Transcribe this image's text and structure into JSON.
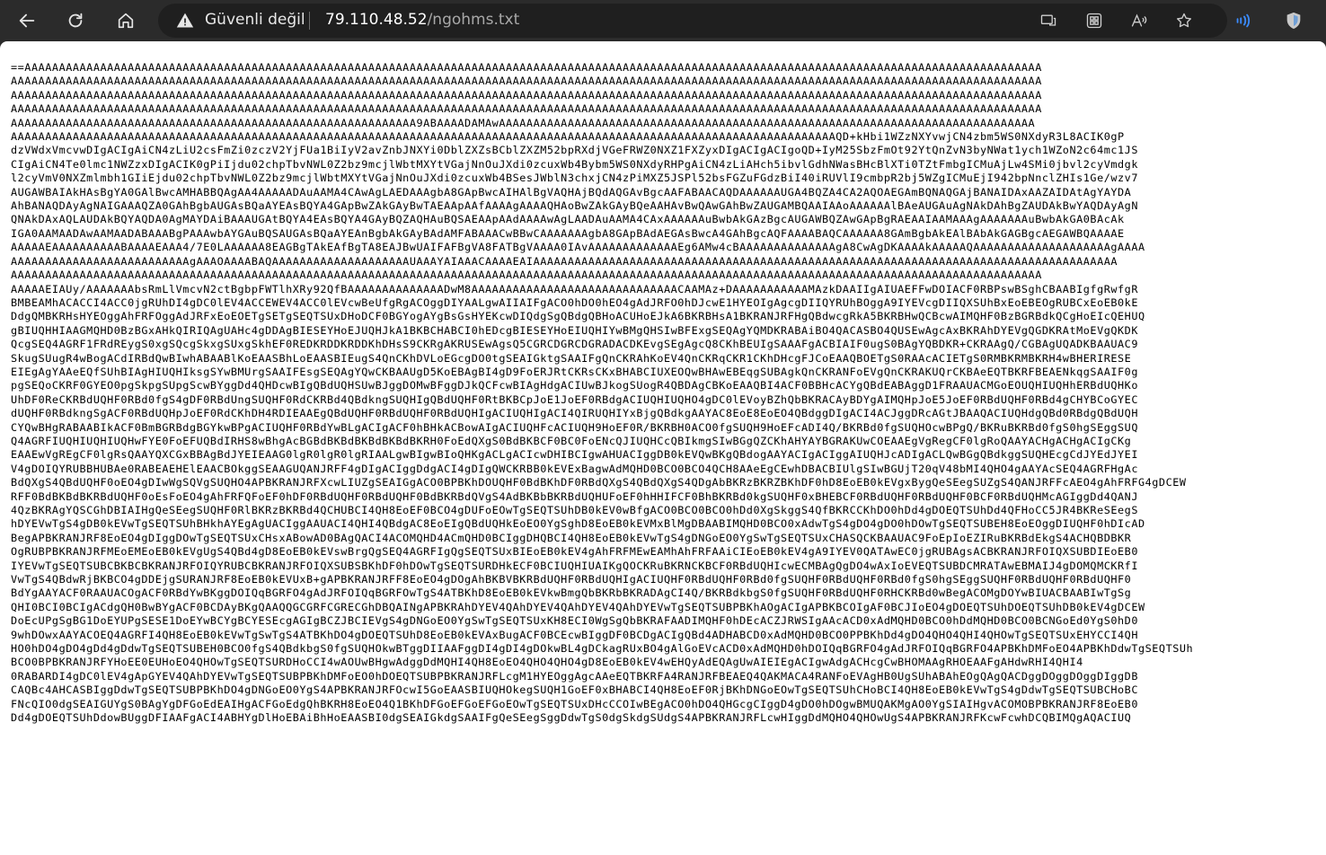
{
  "toolbar": {
    "back_icon": "back-arrow-icon",
    "refresh_icon": "refresh-icon",
    "home_icon": "home-icon"
  },
  "address_bar": {
    "security_icon": "warning-triangle-icon",
    "security_label": "Güvenli değil",
    "url_host": "79.110.48.52",
    "url_path": "/ngohms.txt"
  },
  "address_icons": [
    "app-available-icon",
    "tab-grid-icon",
    "read-aloud-icon",
    "favorite-star-icon"
  ],
  "extension_icons": [
    "audio-extension-icon",
    "shield-extension-icon"
  ],
  "document": {
    "lines": [
      "==AAAAAAAAAAAAAAAAAAAAAAAAAAAAAAAAAAAAAAAAAAAAAAAAAAAAAAAAAAAAAAAAAAAAAAAAAAAAAAAAAAAAAAAAAAAAAAAAAAAAAAAAAAAAAAAAAAAAAAAAAAAAAAAAAAAAAAAAAAAAAAAAAAAA",
      "AAAAAAAAAAAAAAAAAAAAAAAAAAAAAAAAAAAAAAAAAAAAAAAAAAAAAAAAAAAAAAAAAAAAAAAAAAAAAAAAAAAAAAAAAAAAAAAAAAAAAAAAAAAAAAAAAAAAAAAAAAAAAAAAAAAAAAAAAAAAAAAAAAAAAA",
      "AAAAAAAAAAAAAAAAAAAAAAAAAAAAAAAAAAAAAAAAAAAAAAAAAAAAAAAAAAAAAAAAAAAAAAAAAAAAAAAAAAAAAAAAAAAAAAAAAAAAAAAAAAAAAAAAAAAAAAAAAAAAAAAAAAAAAAAAAAAAAAAAAAAAAA",
      "AAAAAAAAAAAAAAAAAAAAAAAAAAAAAAAAAAAAAAAAAAAAAAAAAAAAAAAAAAAAAAAAAAAAAAAAAAAAAAAAAAAAAAAAAAAAAAAAAAAAAAAAAAAAAAAAAAAAAAAAAAAAAAAAAAAAAAAAAAAAAAAAAAAAAA",
      "AAAAAAAAAAAAAAAAAAAAAAAAAAAAAAAAAAAAAAAAAAAAAAAAAAAAAAAAAAA9ABAAAADAMAwAAAAAAAAAAAAAAAAAAAAAAAAAAAAAAAAAAAAAAAAAAAAAAAAAAAAAAAAAAAAAAAAAAAAAAAAAAAAAA",
      "AAAAAAAAAAAAAAAAAAAAAAAAAAAAAAAAAAAAAAAAAAAAAAAAAAAAAAAAAAAAAAAAAAAAAAAAAAAAAAAAAAAAAAAAAAAAAAAAAAAAAAAAAAAAAAAAAAAAAAAAQD+kHbi1WZzNXYvwjCN4zbm5WS0NXdyR3L8ACIK0gP",
      "dzVWdxVmcvwDIgACIgAiCN4zLiU2csFmZi0zczV2YjFUa1BiIyV2avZnbJNXYi0DblZXZsBCblZXZM52bpRXdjVGeFRWZ0NXZ1FXZyxDIgACIgACIgoQD+IyM25SbzFmOt92YtQnZvN3byNWat1ych1WZoN2c64mc1JS",
      "CIgAiCN4Te0lmc1NWZzxDIgACIK0gPiIjdu02chpTbvNWL0Z2bz9mcjlWbtMXYtVGajNnOuJXdi0zcuxWb4Bybm5WS0NXdyRHPgAiCN4zLiAHch5ibvlGdhNWasBHcBlXTi0TZtFmbgICMuAjLw4SMi0jbvl2cyVmdgk",
      "l2cyVmV0NXZmlmbh1GIiEjdu02chpTbvNWL0Z2bz9mcjlWbtMXYtVGajNnOuJXdi0zcuxWb4BSesJWblN3chxjCN4zPiMXZ5JSPl52bsFGZuFGdzBiI40iRUVlI9cmbpR2bj5WZgICMuEjI942bpNnclZHIs1Ge/wzv7",
      "AUGAWBAIAkHAsBgYA0GAlBwcAMHABBQAgAA4AAAAADAuAAMA4CAwAgLAEDAAAgbA8GApBwcAIHAlBgVAQHAjBQdAQGAvBgcAAFABAACAQDAAAAAAUGA4BQZA4CA2AQOAEGAmBQNAQGAjBANAIDAxAAZAIDAtAgYAYDA",
      "AhBANAQDAyAgNAIGAAAQZA0GAhBgbAUGAsBQaAYEAsBQYA4GApBwZAkGAyBwTAEAApAAfAAAAgAAAAQHAoBwZAkGAyBQeAAHAvBwQAwGAhBwZAUGAMBQAAIAAoAAAAAAlBAeAUGAuAgNAkDAhBgZAUDAkBwYAQDAyAgN",
      "QNAkDAxAQLAUDAkBQYAQDA0AgMAYDAiBAAAUGAtBQYA4EAsBQYA4GAyBQZAQHAuBQSAEAApAAdAAAAwAgLAADAuAAMA4CAxAAAAAAuBwbAkGAzBgcAUGAWBQZAwGApBgRAEAAIAAMAAAgAAAAAAAuBwbAkGA0BAcAk",
      "IGA0AAMAADAwAAMAADABAAABgPAAAwbAYGAuBQSAUGAsBQaAYEAnBgbAkGAyBAdAMFABAAACwBBwCAAAAAAAgbA8GApBAdAEGAsBwcA4GAhBgcAQFAAAABAQCAAAAAA8GAmBgbAkEAlBAbAkGAGBgcAEGAWBQAAAAE",
      "AAAAAEAAAAAAAAAABAAAAEAAA4/7E0LAAAAAA8EAGBgTAkEAfBgTA8EAJBwUAIFAFBgVA8FATBgVAAAA0IAvAAAAAAAAAAAAAEg6AMw4cBAAAAAAAAAAAAAAgA8CwAgDKAAAAkAAAAAQAAAAAAAAAAAAAAAAAAAAgAAAA",
      "AAAAAAAAAAAAAAAAAAAAAAAAAAgAAAOAAAABAQAAAAAAAAAAAAAAAAAAAAUAAAYAIAAACAAAAEAIAAAAAAAAAAAAAAAAAAAAAAAAAAAAAAAAAAAAAAAAAAAAAAAAAAAAAAAAAAAAAAAAAAAAAAAAAAAAAAAAAAAAA",
      "AAAAAAAAAAAAAAAAAAAAAAAAAAAAAAAAAAAAAAAAAAAAAAAAAAAAAAAAAAAAAAAAAAAAAAAAAAAAAAAAAAAAAAAAAAAAAAAAAAAAAAAAAAAAAAAAAAAAAAAAAAAAAAAAAAAAAAAAAAAAAAAAAAAAAA",
      "AAAAAEIAUy/AAAAAAAbsRmLlVmcvN2ctBgbpFWTlhXRy92QfBAAAAAAAAAAAAAADwM8AAAAAAAAAAAAAAAAAAAAAAAAAAAAAACAAMAz+DAAAAAAAAAAAMAzkDAAIIgAIUAEFFwDOIACF0RBPswBSghCBAABIgfgRwfgR",
      "BMBEAMhACACCI4ACC0jgRUhDI4gDC0lEV4ACCEWEV4ACC0lEVcwBeUfgRgACOggDIYAALgwAIIAIFgACO0hDO0hEO4gAdJRFO0hDJcwE1HYEOIgAgcgDIIQYRUhBOggA9IYEVcgDIIQXSUhBxEoEBEOgRUBCxEoEB0kE",
      "DdgQMBKRHsHYEOggAhFRFOggAdJRFxEoEOETgSETgSEQTSUxDHoDCF0BGYogAYgBsGsHYEKcwDIQdgSgQBdgQBHoACUHoEJkA6BKRBHsA1BKRANJRFHgQBdwcgRkA5BKRBHwQCBcwAIMQHF0BzBGRBdkQCgHoEIcQEHUQ",
      "gBIUQHHIAAGMQHD0BzBGxAHkQIRIQAgUAHc4gDDAgBIESEYHoEJUQHJkA1BKBCHABCI0hEDcgBIESEYHoEIUQHIYwBMgQHSIwBFExgSEQAgYQMDKRABAiBO4QACASBO4QUSEwAgcAxBKRAhDYEVgQGDKRAtMoEVgQKDK",
      "QcgSEQ4AGRF1FRdREygS0xgSQcgSkxgSUxgSkhEF0REDKRDDKRDDKhDHsS9CKRgAKRUSEwAgsQ5CGRCDGRCDGRADACDKEvgSEgAgcQ8CKhBEUIgSAAAFgACBIAIF0ugS0BAgYQBDKR+CKRAAgQ/CGBAgUQADKBAAUAC9",
      "SkugSUugR4wBogACdIRBdQwBIwhABAABlKoEAASBhLoEAASBIEugS4QnCKhDVLoEGcgDO0tgSEAIGktgSAAIFgQnCKRAhKoEV4QnCKRqCKR1CKhDHcgFJCoEAAQBOETgS0RAAcACIETgS0RMBKRMBKRH4wBHERIRESE",
      "EIEgAgYAAeEQfSUhBIAgHIUQHIksgSYwBMUrgSAAIFEsgSEQAgYQwCKBAAUgD5KoEBAgBI4gD9FoERJRtCKRsCKxBHABCIUXEOQwBHAwEBEqgSUBAgkQnCKRANFoEVgQnCKRAKUQrCKBAeEQTBKRFBEAENkqgSAAIF0g",
      "pgSEQoCKRF0GYEO0pgSkpgSUpgScwBYggDd4QHDcwBIgQBdUQHSUwBJggDOMwBFggDJkQCFcwBIAgHdgACIUwBJkogSUogR4QBDAgCBKoEAAQBI4ACF0BBHcACYgQBdEABAggD1FRAAUACMGoEOUQHIUQHhERBdUQHKo",
      "UhDF0ReCKRBdUQHF0RBd0fgS4gDF0RBdUngSUQHF0RdCKRBd4QBdkngSUQHIgQBdUQHF0RtBKBCpJoE1JoEF0RBdgACIUQHIUQHO4gDC0lEVoyBZhQbBKRACAyBDYgAIMQHpJoE5JoEF0RBdUQHF0RBd4gCHYBCoGYEC",
      "dUQHF0RBdkngSgACF0RBdUQHpJoEF0RdCKhDH4RDIEAAEgQBdUQHF0RBdUQHF0RBdUQHIgACIUQHIgACI4QIRUQHIYxBjgQBdkgAAYAC8EoE8EoEO4QBdggDIgACI4ACJggDRcAGtJBAAQACIUQHdgQBd0RBdgQBdUQH",
      "CYQwBHgRABAABIkACF0BmBGRBdgBGYkwBPgACIUQHF0RBdYwBLgACIgACF0hBHkACBowAIgACIUQHFcACIUQH9HoEF0R/BKRBH0ACO0fgSUQH9HoEFcADI4Q/BKRBd0fgSUQHOcwBPgQ/BKRuBKRBd0fgS0hgSEggSUQ",
      "Q4AGRFIUQHIUQHIUQHwFYE0FoEFUQBdIRHS8wBhgAcBGBdBKBdBKBdBKBdBKRH0FoEdQXgS0BdBKBCF0BC0FoENcQJIUQHCcQBIkmgSIwBGgQZCKhAHYAYBGRAKUwCOEAAEgVgRegCF0lgRoQAAYACHgACHgACIgCKg",
      "EAAEwVgREgCF0lgRsQAAYQXCGxBBAgBdJYEIEAAG0lgR0lgR0lgRIAALgwBIgwBIoQHKgACLgACIcwDHIBCIgwAHUACIggDB0kEVQwBKgQBdogAAYACIgACIggAIUQHJcADIgACLQwBGgQBdkggSUQHEcgCdJYEdJYEI",
      "V4gDOIQYRUBBHUBAe0RABEAEHElEAACBOkggSEAAGUQANJRFF4gDIgACIggDdgACI4gDIgQWCKRBB0kEVExBagwAdMQHD0BCO0BCO4QCH8AAeEgCEwhDBACBIUlgSIwBGUjT20qV48bMI4QHO4gAAYAcSEQ4AGRFHgAc",
      "BdQXgS4QBdUQHF0oEO4gDIwWgSQVgSUQHO4APBKRANJRFXcwLIUZgSEAIGgACO0BPBKhDOUQHF0BdBKhDF0RBdQXgS4QBdQXgS4QDgAbBKRzBKRZBKhDF0hD8EoEB0kEVgxBygQeSEegSUZgS4QANJRFFcAEO4gAhFRFG4gDCEW",
      "RFF0BdBKBdBKRBdUQHF0oEsFoEO4gAhFRFQFoEF0hDF0RBdUQHF0RBdUQHF0BdBKRBdQVgS4AdBKBbBKRBdUQHUFoEF0hHHIFCF0BhBKRBd0kgSUQHF0xBHEBCF0RBdUQHF0RBdUQHF0BCF0RBdUQHMcAGIggDd4QANJ",
      "4QzBKRAgYQSCGhDBIAIHgQeSEegSUQHF0RlBKRzBKRBd4QCHUBCI4QH8EoEF0BCO4gDUFoEOwTgSEQTSUhDB0kEV0wBfgACO0BCO0BCO0hDd0XgSkggS4QfBKRCCKhDO0hDd4gDOEQTSUhDd4QFHoCC5JR4BKReSEegS",
      "hDYEVwTgS4gDB0kEVwTgSEQTSUhBHkhAYEgAgUACIggAAUACI4QHI4QBdgAC8EoEIgQBdUQHkEoEO0YgSghD8EoEB0kEVMxBlMgDBAABIMQHD0BCO0xAdwTgS4gDO4gDO0hDOwTgSEQTSUBEH8EoEOggDIUQHF0hDIcAD",
      "BegAPBKRANJRF8EoEO4gDIggDOwTgSEQTSUxCHsxABowAD0BAgQACI4ACOMQHD4ACmQHD0BCIggDHQBCI4QH8EoEB0kEVwTgS4gDNGoEO0YgSwTgSEQTSUxCHASQCKBAAUAC9FoEpIoEZIRuBKRBdEkgS4ACHQBDBKR",
      "OgRUBPBKRANJRFMEoEMEoEB0kEVgUgS4QBd4gD8EoEB0kEVswBrgQgSEQ4AGRFIgQgSEQTSUxBIEoEB0kEV4gAhFRFMEwEAMhAhFRFAAiCIEoEB0kEV4gA9IYEV0QATAwEC0jgRUBAgsACBKRANJRFOIQXSUBDIEoEB0",
      "IYEVwTgSEQTSUBCBKBCBKRANJRFOIQYRUBCBKRANJRFOIQXSUBSBKhDF0hDOwTgSEQTSURDHkECF0BCIUQHIUAIKgQOCKRuBKRNCKBCF0RBdUQHIcwECMBAgQgDO4wAxIoEVEQTSUBDCMRATAwEBMAIJ4gDOMQMCKRfI",
      "VwTgS4QBdwRjBKBCO4gDDEjgSURANJRF8EoEB0kEVUxB+gAPBKRANJRFF8EoEO4gDOgAhBKBVBKRBdUQHF0RBdUQHIgACIUQHF0RBdUQHF0RBd0fgSUQHF0RBdUQHF0RBd0fgS0hgSEggSUQHF0RBdUQHF0RBdUQHF0",
      "BdYgAAYACF0RAAUACOgACF0RBdYwBKggDOIQqBGRFO4gAdJRFOIQqBGRFOwTgS4ATBKhD8EoEB0kEVkwBmgQbBKRbBKRADAgCI4Q/BKRBdkbgS0fgSUQHF0RBdUQHF0RHCKRBd0wBegACOMgDOYwBIUACBAABIwTgSg",
      "QHI0BCI0BCIgACdgQH0BwBYgACF0BCDAyBKgQAAQQGCGRFCGRECGhDBQAINgAPBKRAhDYEV4QAhDYEV4QAhDYEV4QAhDYEVwTgSEQTSUBPBKhAOgACIgAPBKBCOIgAF0BCJIoEO4gDOEQTSUhDOEQTSUhDB0kEV4gDCEW",
      "DoEcUPgSgBG1DoEYUPgSESE1DoEYwBCYgBCYESEcgAGIgBCZJBCIEVgS4gDNGoEO0YgSwTgSEQTSUxKH8ECI0WgSgQbBKRAFAADIMQHF0hDEcACZJRWSIgAAcACD0xAdMQHD0BCO0hDdMQHD0BCO0BCNGoEd0YgS0hD0",
      "9whDOwxAAYACOEQ4AGRFI4QH8EoEB0kEVwTgSwTgS4ATBKhDO4gDOEQTSUhD8EoEB0kEVAxBugACF0BCEcwBIggDF0BCDgACIgQBd4ADHABCD0xAdMQHD0BCO0PPBKhDd4gDO4QHO4QHI4QHOwTgSEQTSUxEHYCCI4QH",
      "HO0hDO4gDO4gDd4gDdwTgSEQTSUBEH0BCO0fgS4QBdkbgS0fgSUQHOkwBTggDIIAAFggDI4gDI4gDOkwBL4gDCkagRUxBO4gAlGoEVcACD0xAdMQHD0hDOIQqBGRFO4gAdJRFOIQqBGRFO4APBKhDMFoEO4APBKhDdwTgSEQTSUh",
      "BCO0BPBKRANJRFYHoEE0EUHoEO4QHOwTgSEQTSURDHoCCI4wAOUwBHgwAdggDdMQHI4QH8EoEO4QHO4QHO4gD8EoEB0kEV4wEHQyAdEQAgUwAIEIEgACIgwAdgACHcgCwBHOMAAgRHOEAAFgAHdwRHI4QHI4",
      "0RABARDI4gDC0lEV4gApGYEV4QAhDYEVwTgSEQTSUBPBKhDMFoEO0hDOEQTSUBPBKRANJRFLcgM1HYEOggAgcAAeEQTBKRFA4RANJRFBEAEQ4QAKMACA4RANFoEVAgHB0UgSUhABAhEOgQAgQACDggDOggDOggDIggDB",
      "CAQBc4AHCASBIggDdwTgSEQTSUBPBKhDO4gDNGoEO0YgS4APBKRANJRFOcwI5GoEAASBIUQHOkegSUQH1GoEF0xBHABCI4QH8EoEF0RjBKhDNGoEOwTgSEQTSUhCHoBCI4QH8EoEB0kEVwTgS4gDdwTgSEQTSUBCHoBC",
      "FNcQIO0dgSEAIGUYgS0BAgYgDFGoEdEAIHgACFGoEdgQhBKRH8EoEO4Q1BKhDFGoEFGoEFGoEOwTgSEQTSUxDHcCCOIwBEgACO0hDO4QHGcgCIggD4gDO0hDOgwBMUQAKMgAO0YgSIAIHgvACOMOBPBKRANJRF8EoEB0",
      "Dd4gDOEQTSUhDdowBUggDFIAAFgACI4ABHYgDlHoEBAiBhHoEAASBI0dgSEAIGkdgSAAIFgQeSEegSggDdwTgS0dgSkdgSUdgS4APBKRANJRFLcwHIggDdMQHO4QHOwUgS4APBKRANJRFKcwFcwhDCQBIMQgAQACIUQ"
    ]
  }
}
